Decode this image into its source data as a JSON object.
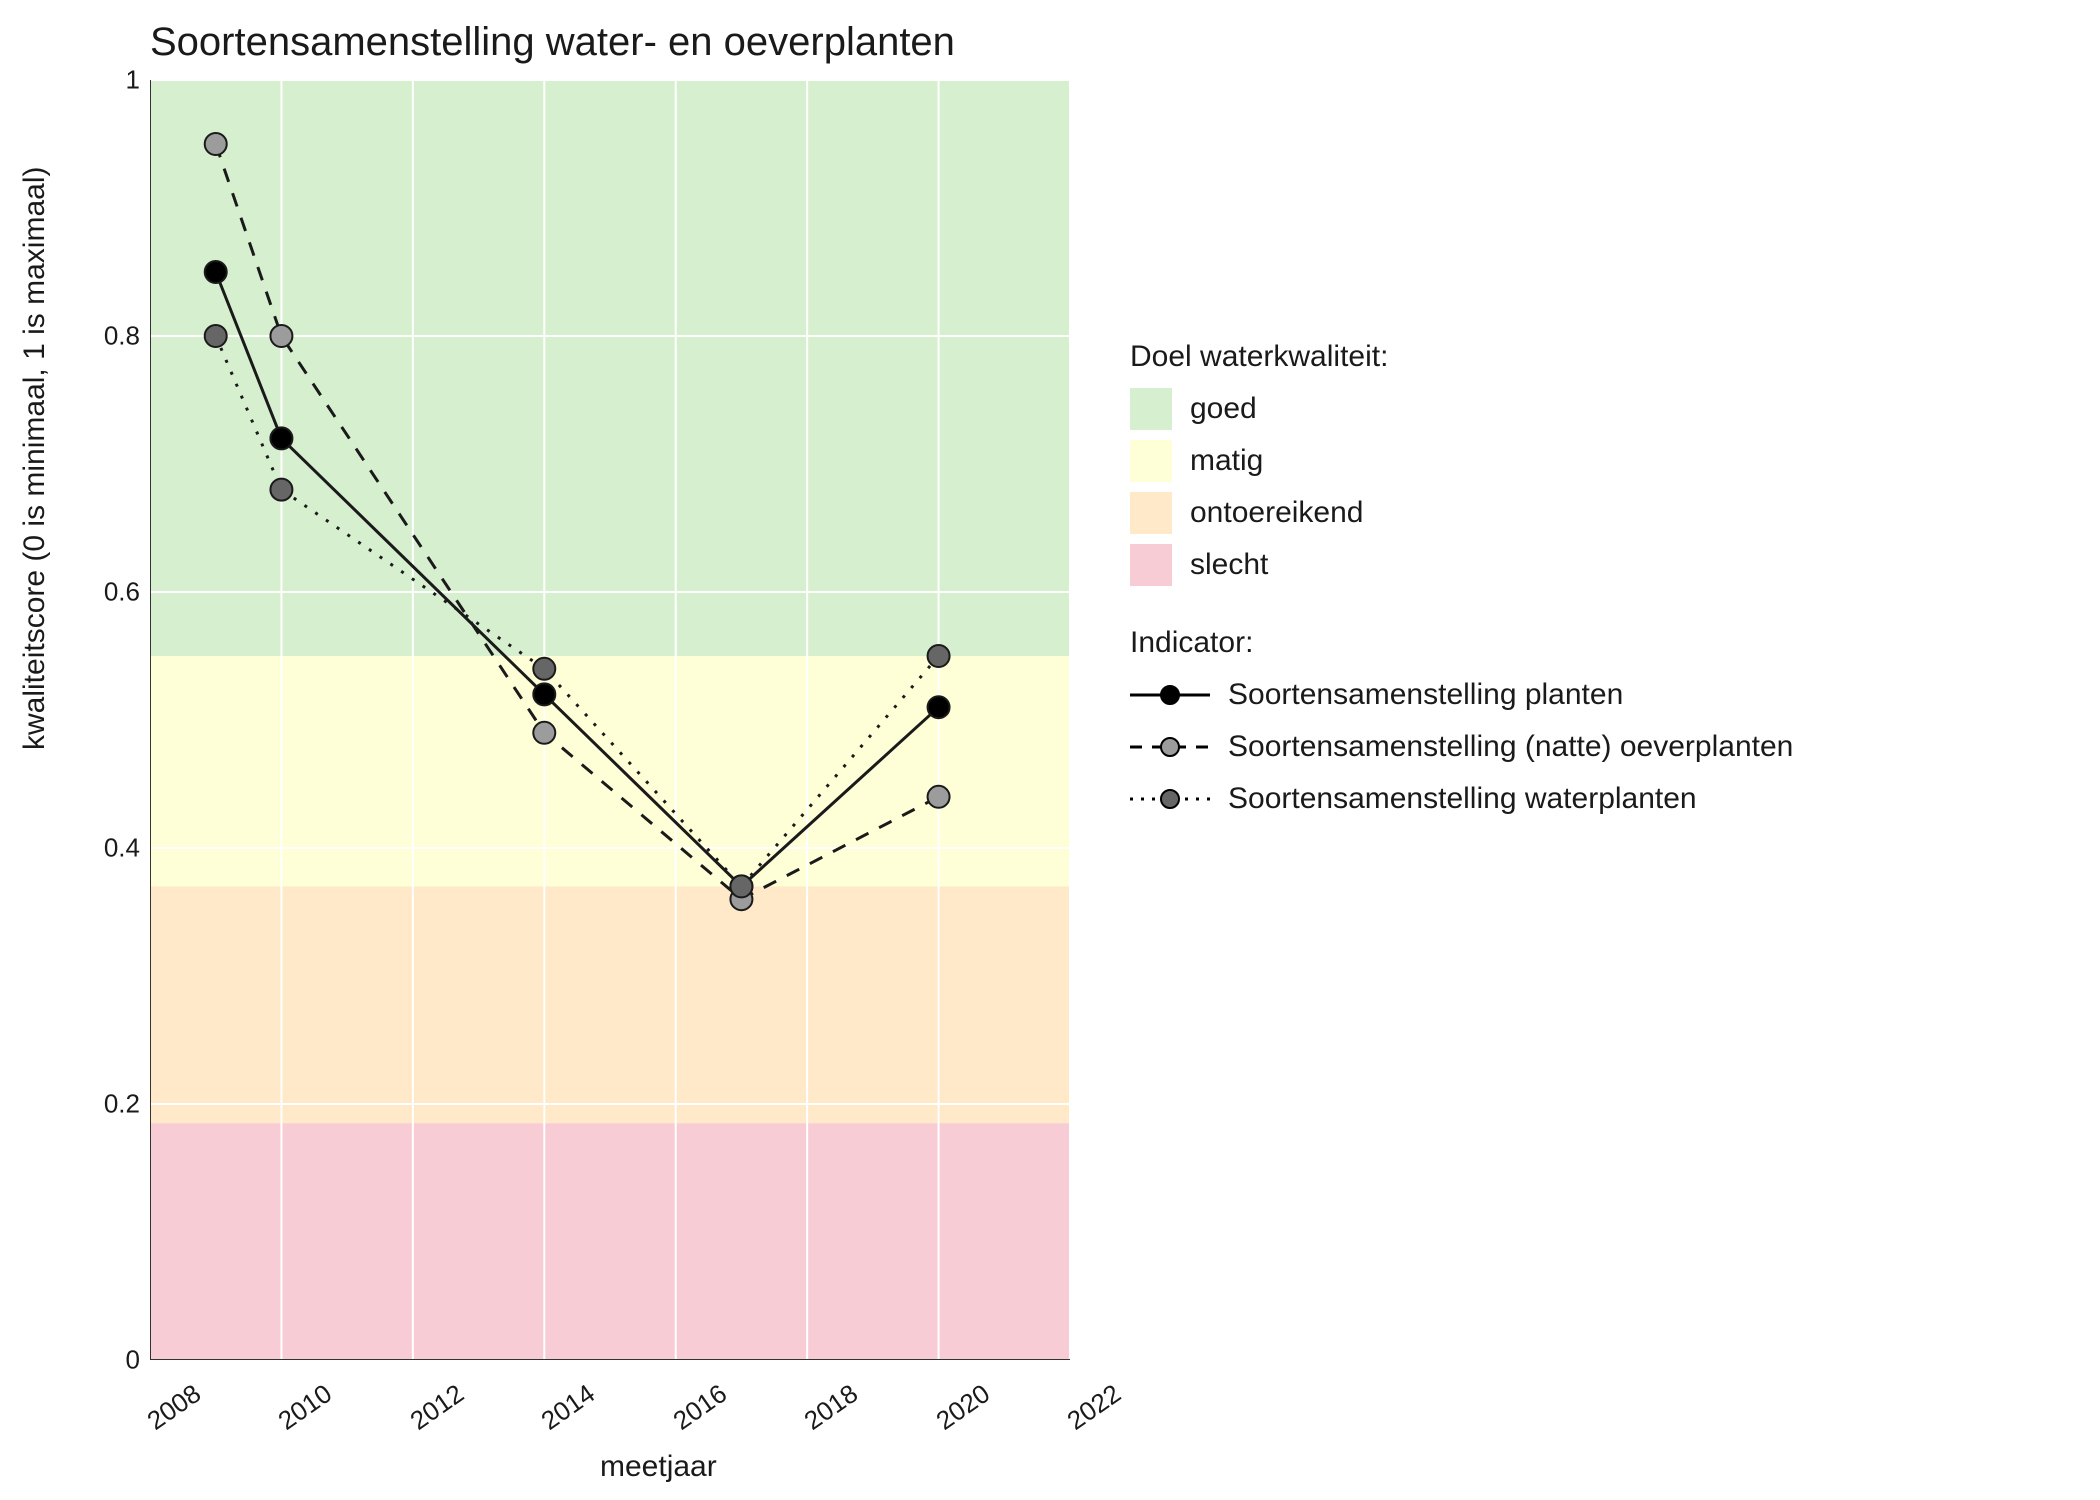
{
  "chart_data": {
    "type": "line",
    "title": "Soortensamenstelling water- en oeverplanten",
    "xlabel": "meetjaar",
    "ylabel": "kwaliteitscore (0 is minimaal, 1 is maximaal)",
    "xlim": [
      2008,
      2022
    ],
    "ylim": [
      0.0,
      1.0
    ],
    "x": [
      2009,
      2010,
      2014,
      2017,
      2020
    ],
    "x_ticks": [
      2008,
      2010,
      2012,
      2014,
      2016,
      2018,
      2020,
      2022
    ],
    "y_ticks": [
      0.0,
      0.2,
      0.4,
      0.6,
      0.8,
      1.0
    ],
    "bands": [
      {
        "label": "goed",
        "y0": 0.55,
        "y1": 1.0,
        "fill": "#d6efce"
      },
      {
        "label": "matig",
        "y0": 0.37,
        "y1": 0.55,
        "fill": "#feffd6"
      },
      {
        "label": "ontoereikend",
        "y0": 0.185,
        "y1": 0.37,
        "fill": "#ffe9c9"
      },
      {
        "label": "slecht",
        "y0": 0.0,
        "y1": 0.185,
        "fill": "#f8ccd5"
      }
    ],
    "series": [
      {
        "name": "Soortensamenstelling planten",
        "values": [
          0.85,
          0.72,
          0.52,
          0.37,
          0.51
        ],
        "dash": "solid",
        "point_fill": "#000000"
      },
      {
        "name": "Soortensamenstelling (natte) oeverplanten",
        "values": [
          0.95,
          0.8,
          0.49,
          0.36,
          0.44
        ],
        "dash": "dashed",
        "point_fill": "#9c9c9c"
      },
      {
        "name": "Soortensamenstelling waterplanten",
        "values": [
          0.8,
          0.68,
          0.54,
          0.37,
          0.55
        ],
        "dash": "dotted",
        "point_fill": "#666666"
      }
    ],
    "legend_groups": [
      {
        "title": "Doel waterkwaliteit:",
        "type": "fill",
        "items": [
          "goed",
          "matig",
          "ontoereikend",
          "slecht"
        ]
      },
      {
        "title": "Indicator:",
        "type": "line",
        "items": [
          "Soortensamenstelling planten",
          "Soortensamenstelling (natte) oeverplanten",
          "Soortensamenstelling waterplanten"
        ]
      }
    ]
  }
}
